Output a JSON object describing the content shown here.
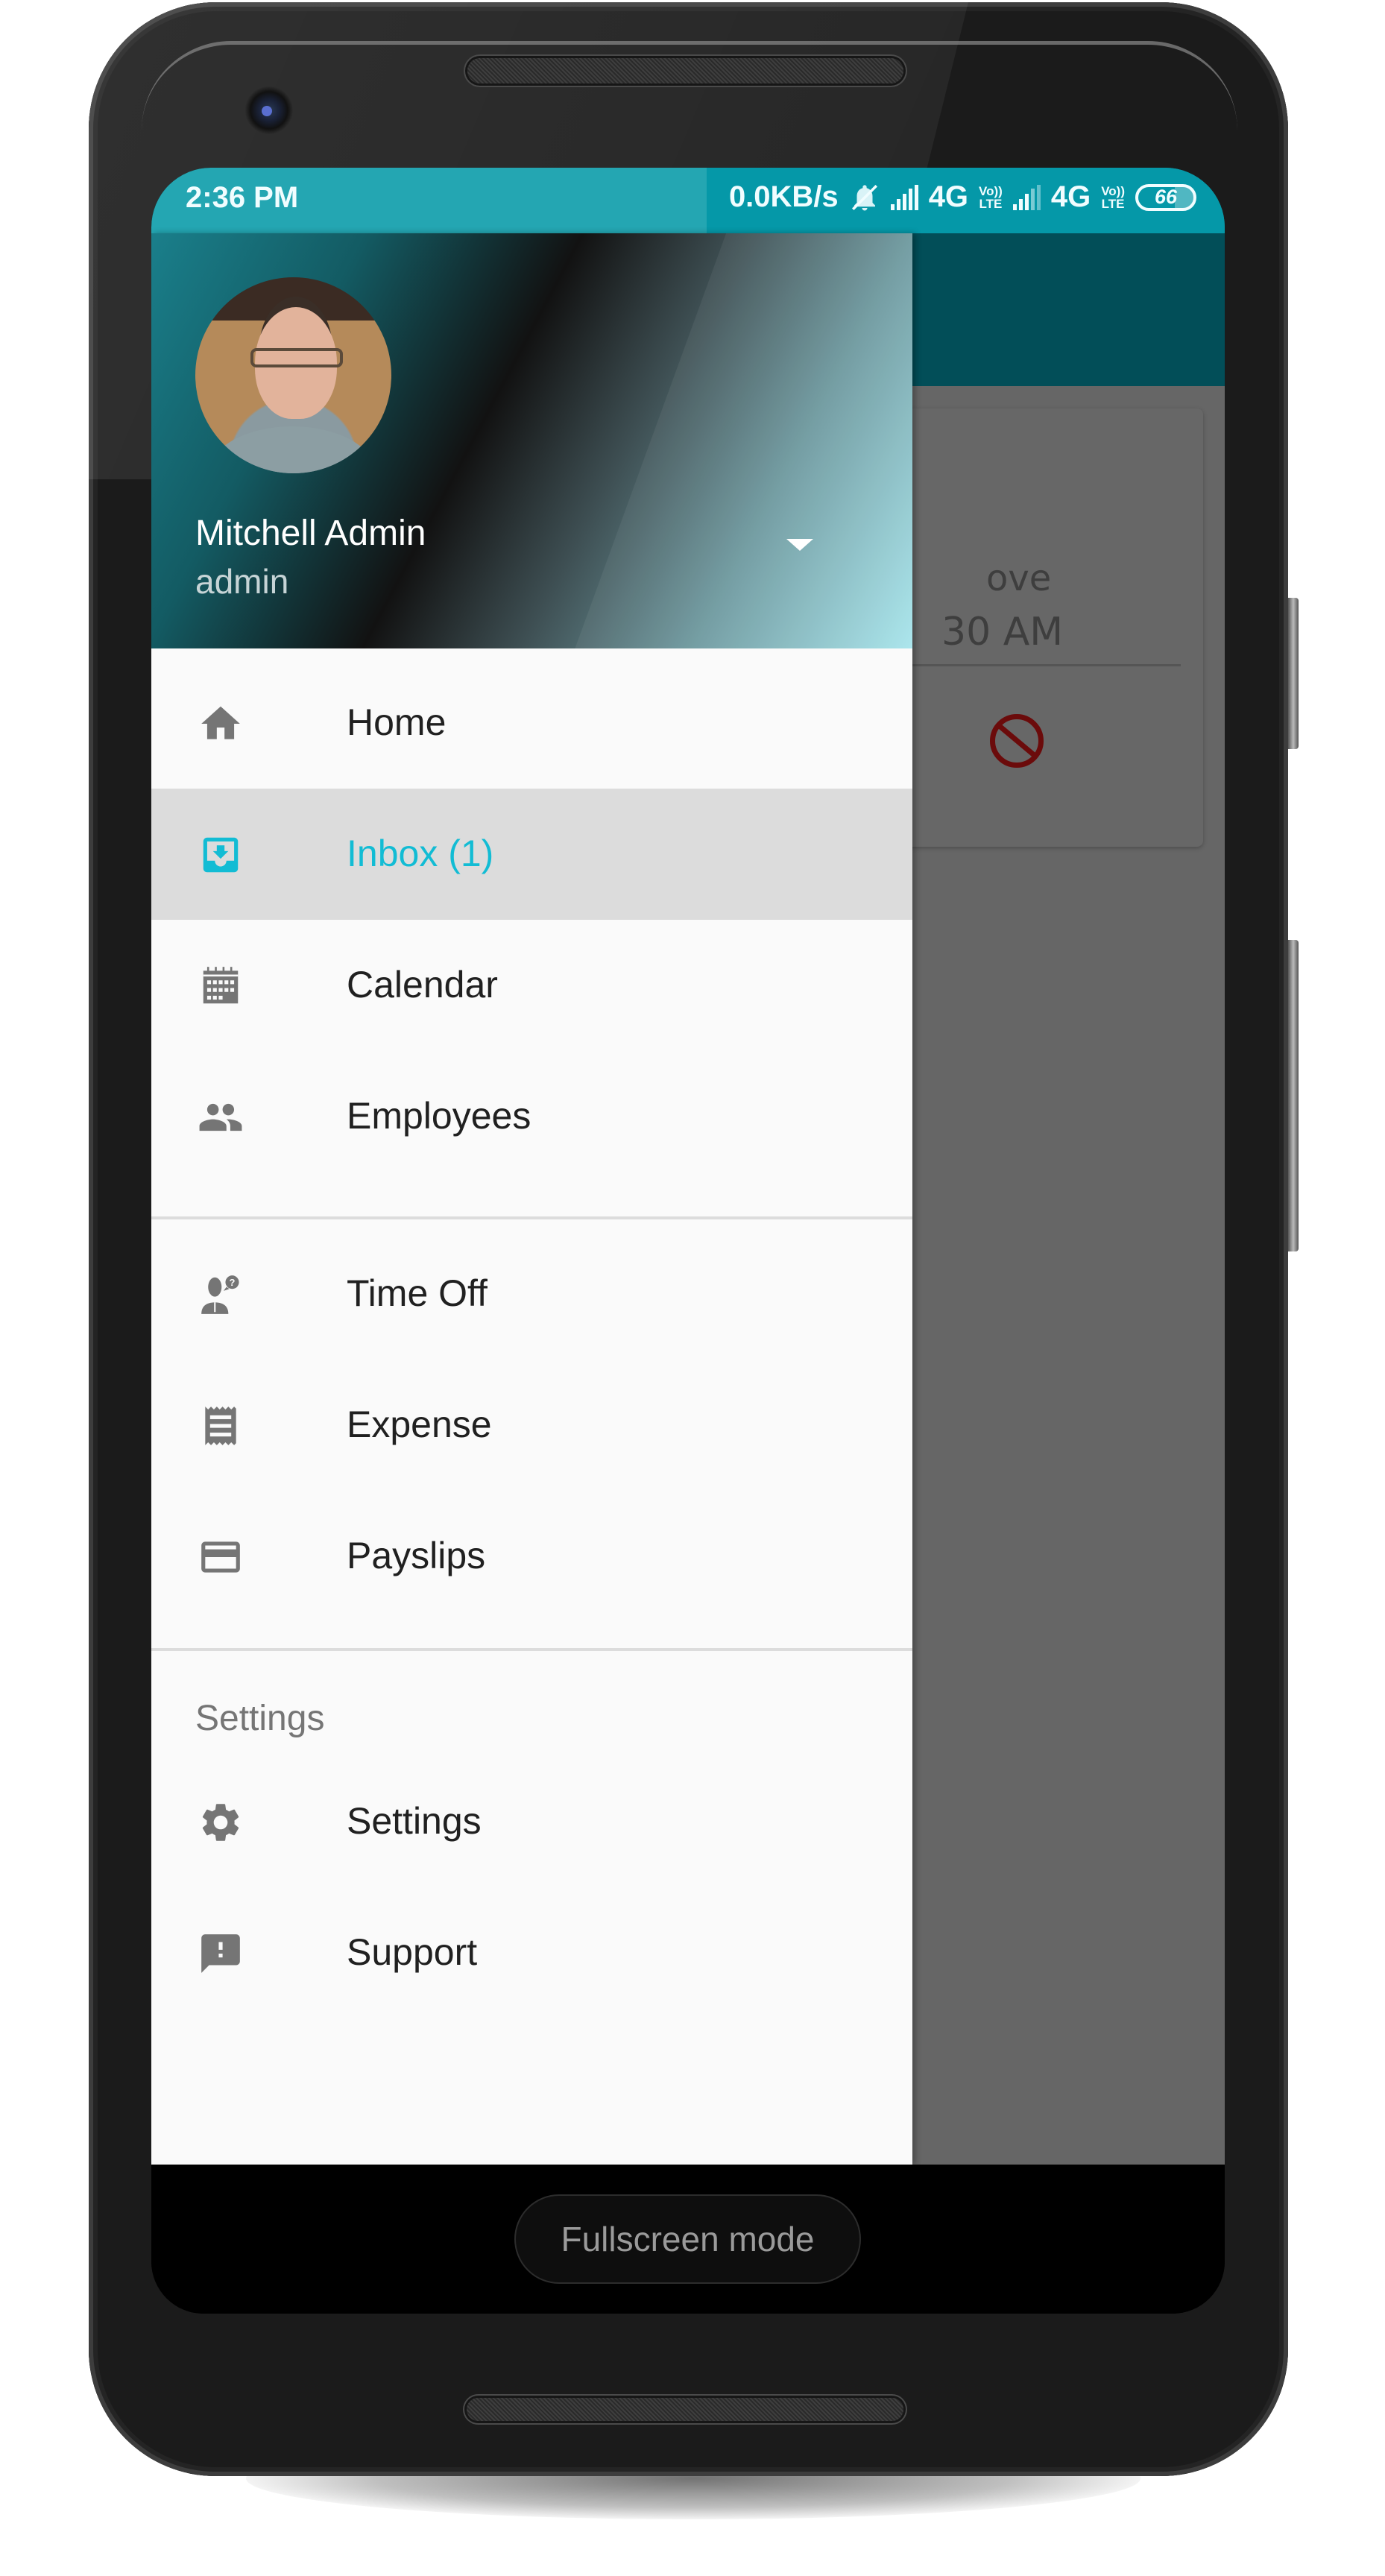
{
  "status_bar": {
    "time": "2:36 PM",
    "net_speed": "0.0KB/s",
    "sim1_network": "4G",
    "sim2_network": "4G",
    "volte_top": "Vo))",
    "volte_bottom": "LTE",
    "battery": "66",
    "icons": [
      "notifications-muted-icon",
      "signal-icon",
      "signal-icon",
      "battery-icon"
    ]
  },
  "background_app": {
    "card_line1": "ove",
    "card_line2": "30 AM",
    "card_action_icon": "block-icon"
  },
  "drawer": {
    "user": {
      "name": "Mitchell Admin",
      "login": "admin"
    },
    "items": [
      {
        "label": "Home",
        "icon": "home-icon",
        "active": false
      },
      {
        "label": "Inbox (1)",
        "icon": "inbox-icon",
        "active": true
      },
      {
        "label": "Calendar",
        "icon": "calendar-icon",
        "active": false
      },
      {
        "label": "Employees",
        "icon": "people-icon",
        "active": false
      },
      {
        "label": "Time Off",
        "icon": "time-off-icon",
        "active": false
      },
      {
        "label": "Expense",
        "icon": "receipt-icon",
        "active": false
      },
      {
        "label": "Payslips",
        "icon": "credit-card-icon",
        "active": false
      }
    ],
    "section_label": "Settings",
    "settings_items": [
      {
        "label": "Settings",
        "icon": "gear-icon"
      },
      {
        "label": "Support",
        "icon": "feedback-icon"
      }
    ]
  },
  "system": {
    "fullscreen_button": "Fullscreen mode"
  },
  "colors": {
    "accent": "#12bcd4",
    "status_bar": "#24a6b2",
    "toolbar": "#024e58",
    "icon_gray": "#757575",
    "block_red": "#6b0b0b"
  }
}
